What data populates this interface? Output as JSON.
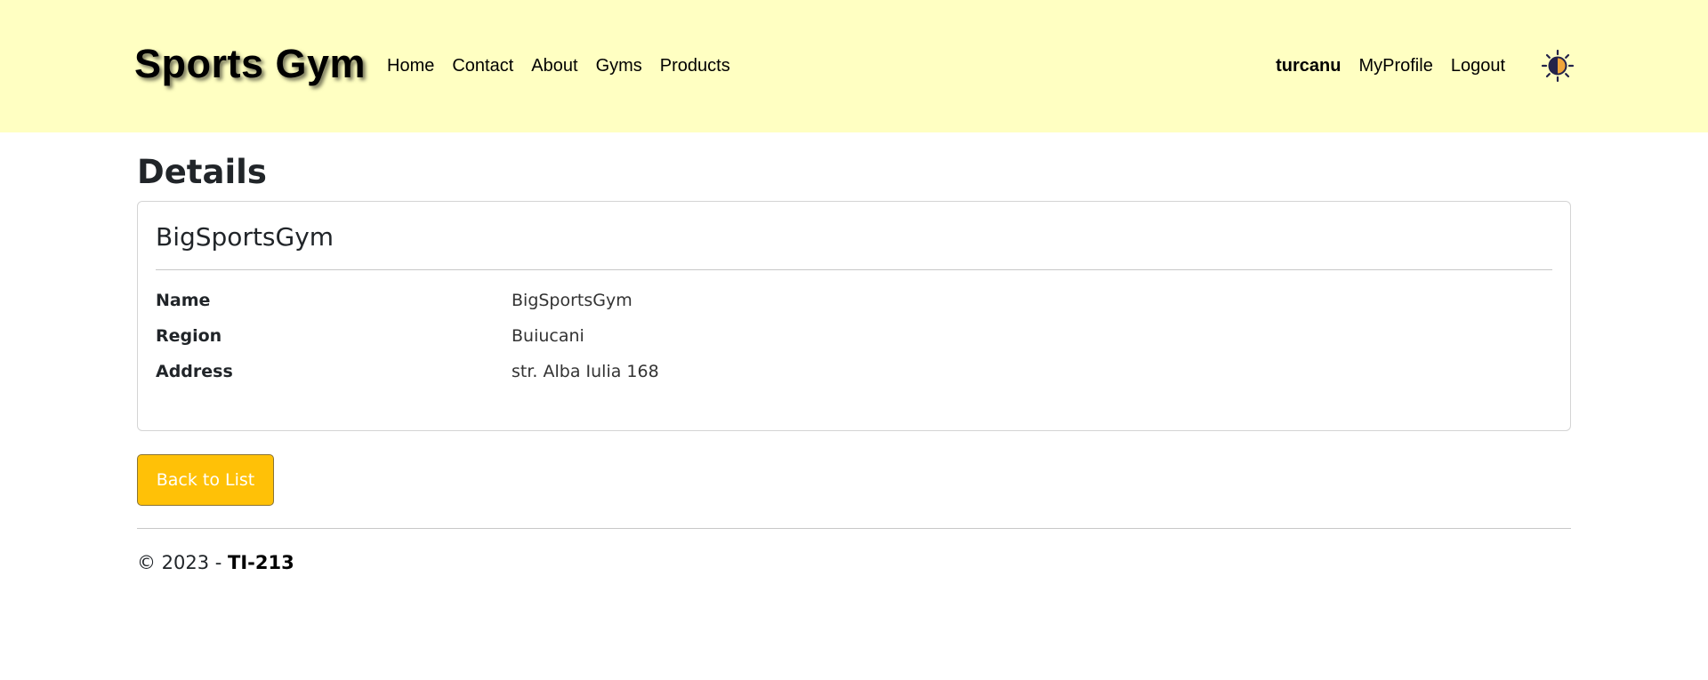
{
  "header": {
    "brand": "Sports Gym",
    "background_color": "#ffffc2",
    "nav": [
      {
        "label": "Home"
      },
      {
        "label": "Contact"
      },
      {
        "label": "About"
      },
      {
        "label": "Gyms"
      },
      {
        "label": "Products"
      }
    ],
    "user": {
      "username": "turcanu",
      "profile_label": "MyProfile",
      "logout_label": "Logout"
    },
    "theme_toggle_icon": "half-sun-icon"
  },
  "main": {
    "heading": "Details",
    "card": {
      "title": "BigSportsGym",
      "fields": [
        {
          "term": "Name",
          "value": "BigSportsGym"
        },
        {
          "term": "Region",
          "value": "Buiucani"
        },
        {
          "term": "Address",
          "value": "str. Alba Iulia 168"
        }
      ]
    },
    "back_button": {
      "label": "Back to List",
      "color": "#ffc107"
    }
  },
  "footer": {
    "prefix": "© 2023 - ",
    "group": "TI-213"
  }
}
